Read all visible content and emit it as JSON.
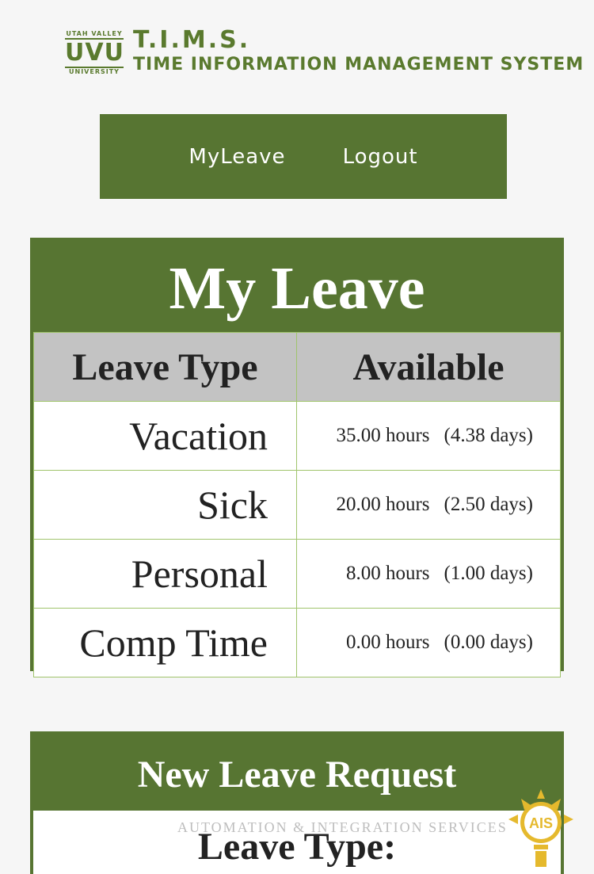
{
  "header": {
    "badge_top": "UTAH VALLEY",
    "badge_main": "UVU",
    "badge_bottom": "UNIVERSITY",
    "app_title": "T.I.M.S.",
    "app_subtitle": "TIME INFORMATION MANAGEMENT SYSTEM"
  },
  "nav": {
    "myleave": "MyLeave",
    "logout": "Logout"
  },
  "my_leave": {
    "title": "My Leave",
    "columns": [
      "Leave Type",
      "Available"
    ],
    "rows": [
      {
        "type": "Vacation",
        "hours": "35.00 hours",
        "days": "(4.38 days)"
      },
      {
        "type": "Sick",
        "hours": "20.00 hours",
        "days": "(2.50 days)"
      },
      {
        "type": "Personal",
        "hours": "8.00 hours",
        "days": "(1.00 days)"
      },
      {
        "type": "Comp Time",
        "hours": "0.00 hours",
        "days": "(0.00 days)"
      }
    ]
  },
  "new_request": {
    "title": "New Leave Request",
    "leave_type_label": "Leave Type:"
  },
  "watermark": {
    "text": "AUTOMATION & INTEGRATION SERVICES",
    "logo_text": "AIS"
  },
  "colors": {
    "brand_green": "#577532",
    "header_gray": "#c3c3c3",
    "cell_border": "#a0c46c",
    "ais_gold": "#e5b92d"
  }
}
